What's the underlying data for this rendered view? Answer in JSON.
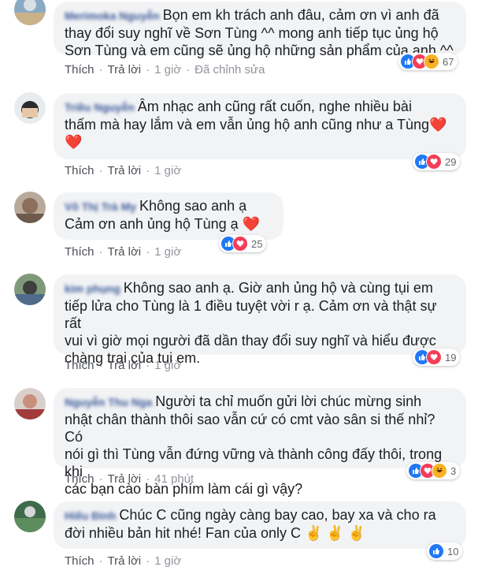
{
  "comments": [
    {
      "author": "Merimoka Nguyễn",
      "lines": [
        "Bọn em kh trách anh đâu, cảm ơn vì anh đã",
        "thay đổi suy nghĩ về Sơn Tùng ^^ mong anh tiếp tục ủng hộ",
        "Sơn Tùng và em cũng sẽ ủng hộ những sản phẩm của anh ^^"
      ],
      "like": "Thích",
      "reply": "Trả lời",
      "time": "1 giờ",
      "edited": "Đã chỉnh sửa",
      "reactions": [
        "like",
        "love",
        "haha"
      ],
      "count": "67"
    },
    {
      "author": "Triều Nguyễn",
      "lines": [
        "Âm nhạc anh cũng rất cuốn, nghe nhiều bài",
        "thấm mà hay lắm và em vẫn ủng hộ anh cũng như a Tùng",
        "❤️"
      ],
      "like": "Thích",
      "reply": "Trả lời",
      "time": "1 giờ",
      "reactions": [
        "like",
        "love"
      ],
      "count": "29"
    },
    {
      "author": "Võ Thị Trà My",
      "lines": [
        "Không sao anh ạ",
        "Cảm ơn anh ủng hộ Tùng ạ ❤️"
      ],
      "like": "Thích",
      "reply": "Trả lời",
      "time": "1 giờ",
      "reactions": [
        "like",
        "love"
      ],
      "count": "25"
    },
    {
      "author": "kim phụng",
      "lines": [
        "Không sao anh ạ. Giờ anh ủng hộ và cùng tụi em",
        "tiếp lửa cho Tùng là 1 điều tuyệt vời r ạ. Cảm ơn và thật sự rất",
        "vui vì giờ mọi người đã dần thay đổi suy nghĩ và hiểu được",
        "chàng trai của tụi em."
      ],
      "like": "Thích",
      "reply": "Trả lời",
      "time": "1 giờ",
      "reactions": [
        "like",
        "love"
      ],
      "count": "19"
    },
    {
      "author": "Nguyễn Thu Nga",
      "lines": [
        "Người ta chỉ muốn gửi lời chúc mừng sinh",
        "nhật chân thành thôi sao vẫn cứ có cmt vào sân si thế nhỉ? Có",
        "nói gì thì Tùng vẫn đứng vững và thành công đấy thôi, trong khi",
        "các bạn cào bàn phím làm cái gì vậy?"
      ],
      "like": "Thích",
      "reply": "Trả lời",
      "time": "41 phút",
      "reactions": [
        "like",
        "love",
        "haha"
      ],
      "count": "3"
    },
    {
      "author": "Hiếu Đinh",
      "lines": [
        "Chúc C cũng ngày càng bay cao, bay xa và cho ra",
        "đời nhiều bản hit nhé! Fan của only C ✌️ ✌️ ✌️"
      ],
      "like": "Thích",
      "reply": "Trả lời",
      "time": "1 giờ",
      "reactions": [
        "like"
      ],
      "count": "10"
    }
  ],
  "colors": {
    "like": "#2078f4",
    "love": "#f33e58",
    "haha": "#f7b125",
    "name": "#385898",
    "bubble": "#f2f3f5"
  }
}
